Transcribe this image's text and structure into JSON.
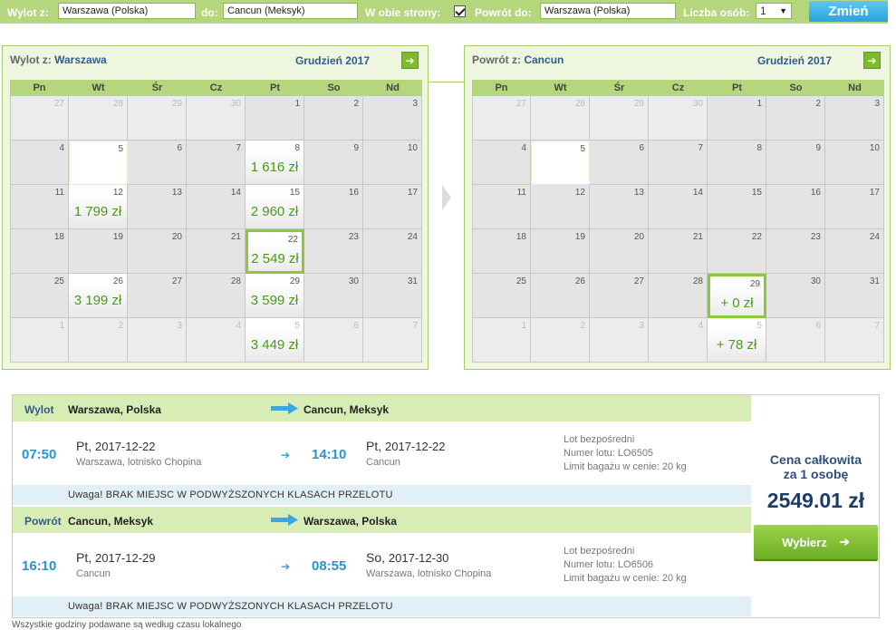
{
  "search": {
    "from_label": "Wylot z:",
    "from_value": "Warszawa (Polska)",
    "to_label": "do:",
    "to_value": "Cancun (Meksyk)",
    "roundtrip_label": "W obie strony:",
    "roundtrip_checked": true,
    "return_label": "Powrót do:",
    "return_value": "Warszawa (Polska)",
    "persons_label": "Liczba osób:",
    "persons_value": "1",
    "change_button": "Zmień"
  },
  "days_of_week": [
    "Pn",
    "Wt",
    "Śr",
    "Cz",
    "Pt",
    "So",
    "Nd"
  ],
  "outbound_calendar": {
    "title_prefix": "Wylot z:",
    "title_city": "Warszawa",
    "month": "Grudzień 2017",
    "weeks": [
      [
        {
          "d": "27",
          "out": true
        },
        {
          "d": "28",
          "out": true
        },
        {
          "d": "29",
          "out": true
        },
        {
          "d": "30",
          "out": true
        },
        {
          "d": "1"
        },
        {
          "d": "2"
        },
        {
          "d": "3"
        }
      ],
      [
        {
          "d": "4"
        },
        {
          "d": "5",
          "cur": true
        },
        {
          "d": "6"
        },
        {
          "d": "7"
        },
        {
          "d": "8",
          "price": "1 616 zł"
        },
        {
          "d": "9"
        },
        {
          "d": "10"
        }
      ],
      [
        {
          "d": "11"
        },
        {
          "d": "12",
          "price": "1 799 zł"
        },
        {
          "d": "13"
        },
        {
          "d": "14"
        },
        {
          "d": "15",
          "price": "2 960 zł"
        },
        {
          "d": "16"
        },
        {
          "d": "17"
        }
      ],
      [
        {
          "d": "18"
        },
        {
          "d": "19"
        },
        {
          "d": "20"
        },
        {
          "d": "21"
        },
        {
          "d": "22",
          "price": "2 549 zł",
          "sel": true
        },
        {
          "d": "23"
        },
        {
          "d": "24"
        }
      ],
      [
        {
          "d": "25"
        },
        {
          "d": "26",
          "price": "3 199 zł"
        },
        {
          "d": "27"
        },
        {
          "d": "28"
        },
        {
          "d": "29",
          "price": "3 599 zł"
        },
        {
          "d": "30"
        },
        {
          "d": "31"
        }
      ],
      [
        {
          "d": "1",
          "out": true
        },
        {
          "d": "2",
          "out": true
        },
        {
          "d": "3",
          "out": true
        },
        {
          "d": "4",
          "out": true
        },
        {
          "d": "5",
          "out": true,
          "price": "3 449 zł"
        },
        {
          "d": "6",
          "out": true
        },
        {
          "d": "7",
          "out": true
        }
      ]
    ]
  },
  "return_calendar": {
    "title_prefix": "Powrót z:",
    "title_city": "Cancun",
    "month": "Grudzień 2017",
    "weeks": [
      [
        {
          "d": "27",
          "out": true
        },
        {
          "d": "28",
          "out": true
        },
        {
          "d": "29",
          "out": true
        },
        {
          "d": "30",
          "out": true
        },
        {
          "d": "1"
        },
        {
          "d": "2"
        },
        {
          "d": "3"
        }
      ],
      [
        {
          "d": "4"
        },
        {
          "d": "5",
          "cur": true
        },
        {
          "d": "6"
        },
        {
          "d": "7"
        },
        {
          "d": "8"
        },
        {
          "d": "9"
        },
        {
          "d": "10"
        }
      ],
      [
        {
          "d": "11"
        },
        {
          "d": "12"
        },
        {
          "d": "13"
        },
        {
          "d": "14"
        },
        {
          "d": "15"
        },
        {
          "d": "16"
        },
        {
          "d": "17"
        }
      ],
      [
        {
          "d": "18"
        },
        {
          "d": "19"
        },
        {
          "d": "20"
        },
        {
          "d": "21"
        },
        {
          "d": "22"
        },
        {
          "d": "23"
        },
        {
          "d": "24"
        }
      ],
      [
        {
          "d": "25"
        },
        {
          "d": "26"
        },
        {
          "d": "27"
        },
        {
          "d": "28"
        },
        {
          "d": "29",
          "price": "+ 0 zł",
          "sel": true
        },
        {
          "d": "30"
        },
        {
          "d": "31"
        }
      ],
      [
        {
          "d": "1",
          "out": true
        },
        {
          "d": "2",
          "out": true
        },
        {
          "d": "3",
          "out": true
        },
        {
          "d": "4",
          "out": true
        },
        {
          "d": "5",
          "out": true,
          "price": "+ 78 zł"
        },
        {
          "d": "6",
          "out": true
        },
        {
          "d": "7",
          "out": true
        }
      ]
    ]
  },
  "outbound": {
    "band_label": "Wylot",
    "from": "Warszawa, Polska",
    "to": "Cancun, Meksyk",
    "dep_time": "07:50",
    "dep_dow": "Pt,",
    "dep_date": "2017-12-22",
    "dep_place": "Warszawa, lotnisko Chopina",
    "arr_time": "14:10",
    "arr_dow": "Pt,",
    "arr_date": "2017-12-22",
    "arr_place": "Cancun",
    "info_direct": "Lot bezpośredni",
    "info_flight": "Numer lotu: LO6505",
    "info_baggage": "Limit bagażu w cenie: 20 kg",
    "notice": "Uwaga! BRAK MIEJSC W PODWYŻSZONYCH KLASACH PRZELOTU"
  },
  "return": {
    "band_label": "Powrót",
    "from": "Cancun, Meksyk",
    "to": "Warszawa, Polska",
    "dep_time": "16:10",
    "dep_dow": "Pt,",
    "dep_date": "2017-12-29",
    "dep_place": "Cancun",
    "arr_time": "08:55",
    "arr_dow": "So,",
    "arr_date": "2017-12-30",
    "arr_place": "Warszawa, lotnisko Chopina",
    "info_direct": "Lot bezpośredni",
    "info_flight": "Numer lotu: LO6506",
    "info_baggage": "Limit bagażu w cenie: 20 kg",
    "notice": "Uwaga! BRAK MIEJSC W PODWYŻSZONYCH KLASACH PRZELOTU"
  },
  "pricebox": {
    "label_line1": "Cena całkowita",
    "label_line2": "za 1 osobę",
    "price": "2549.01 zł",
    "select_button": "Wybierz"
  },
  "footnote": "Wszystkie godziny podawane są według czasu lokalnego",
  "colors": {
    "accent_green": "#8dc63f",
    "band_green": "#d8ecb6",
    "time_blue": "#2a93d5",
    "title_blue": "#2f5d8a"
  }
}
